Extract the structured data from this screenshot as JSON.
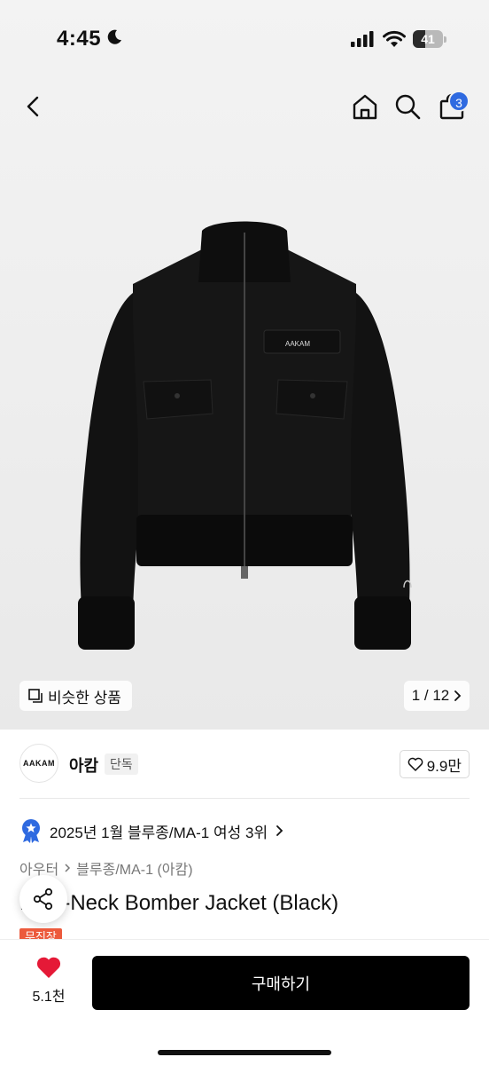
{
  "status_bar": {
    "time": "4:45",
    "battery": "41",
    "battery_level": 0.41
  },
  "header": {
    "cart_count": "3"
  },
  "gallery": {
    "similar_label": "비슷한 상품",
    "counter": "1 / 12",
    "image_icon": "jacket-product-photo"
  },
  "jacket_logo": "AAKAM",
  "brand": {
    "logo_text": "AAKAM",
    "name": "아캄",
    "badge": "단독",
    "likes": "9.9만"
  },
  "ranking": {
    "text": "2025년 1월 블루종/MA-1 여성 3위"
  },
  "breadcrumb": {
    "category": "아우터",
    "subcategory": "블루종/MA-1 (아캄)"
  },
  "product": {
    "title": "High-Neck Bomber Jacket (Black)",
    "tag": "무진장"
  },
  "bottom": {
    "like_count": "5.1천",
    "buy_label": "구매하기"
  },
  "colors": {
    "accent_blue": "#2f6ae0",
    "heart_red": "#e51937",
    "tag_orange": "#ec5a3c"
  }
}
